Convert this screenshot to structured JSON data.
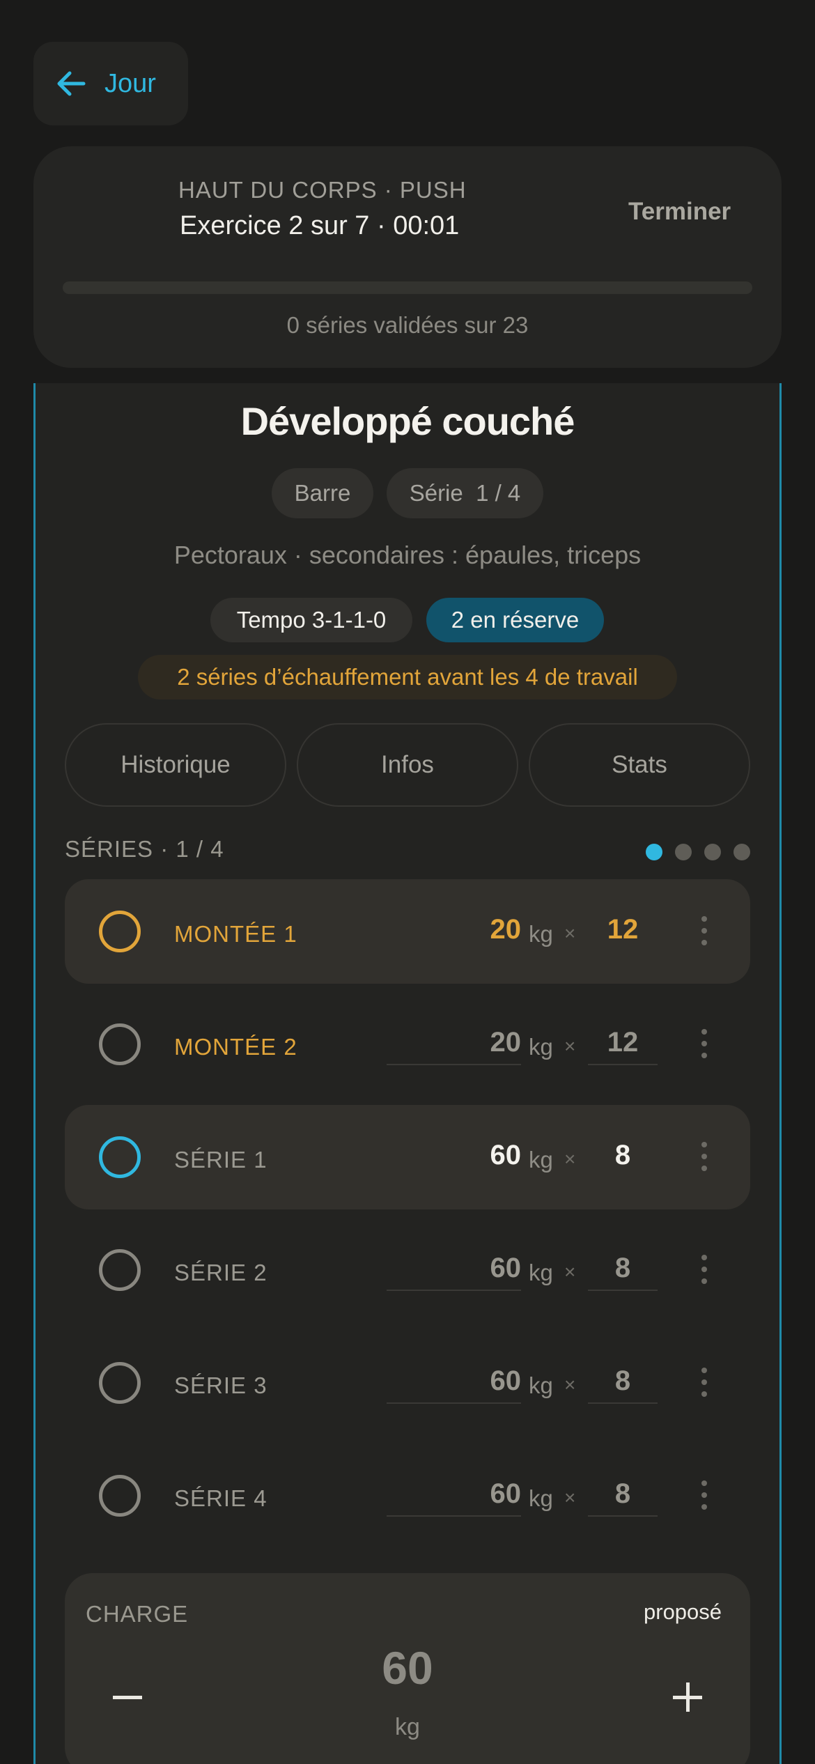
{
  "nav": {
    "back_label": "Jour"
  },
  "session": {
    "subtitle": "HAUT DU CORPS · PUSH",
    "title": "Exercice 2 sur 7 · 00:01",
    "finish_label": "Terminer",
    "progress_fraction": 0,
    "progress_text": "0 séries validées sur 23"
  },
  "exercise": {
    "name": "Développé couché",
    "equipment": "Barre",
    "set_badge": "Série  1 / 4",
    "muscles": "Pectoraux · secondaires : épaules, triceps",
    "tempo": "Tempo 3-1-1-0",
    "reserve": "2 en réserve",
    "warmup_note": "2 séries d’échauffement avant les 4 de travail"
  },
  "tabs": [
    "Historique",
    "Infos",
    "Stats"
  ],
  "series": {
    "header": "SÉRIES · 1 / 4",
    "rows": [
      {
        "label": "MONTÉE 1",
        "weight": "20",
        "unit": "kg",
        "times": "×",
        "reps": "12"
      },
      {
        "label": "MONTÉE 2",
        "weight": "20",
        "unit": "kg",
        "times": "×",
        "reps": "12"
      },
      {
        "label": "SÉRIE 1",
        "weight": "60",
        "unit": "kg",
        "times": "×",
        "reps": "8"
      },
      {
        "label": "SÉRIE 2",
        "weight": "60",
        "unit": "kg",
        "times": "×",
        "reps": "8"
      },
      {
        "label": "SÉRIE 3",
        "weight": "60",
        "unit": "kg",
        "times": "×",
        "reps": "8"
      },
      {
        "label": "SÉRIE 4",
        "weight": "60",
        "unit": "kg",
        "times": "×",
        "reps": "8"
      }
    ]
  },
  "charge": {
    "label": "CHARGE",
    "proposed": "proposé",
    "value": "60",
    "unit": "kg"
  },
  "colors": {
    "accent": "#30b8e0",
    "warmup": "#e2a53a",
    "reserve_bg": "#11536b",
    "background": "#1a1a19"
  },
  "icons": [
    "arrow-left-icon",
    "kebab-menu-icon",
    "minus-icon",
    "plus-icon"
  ]
}
